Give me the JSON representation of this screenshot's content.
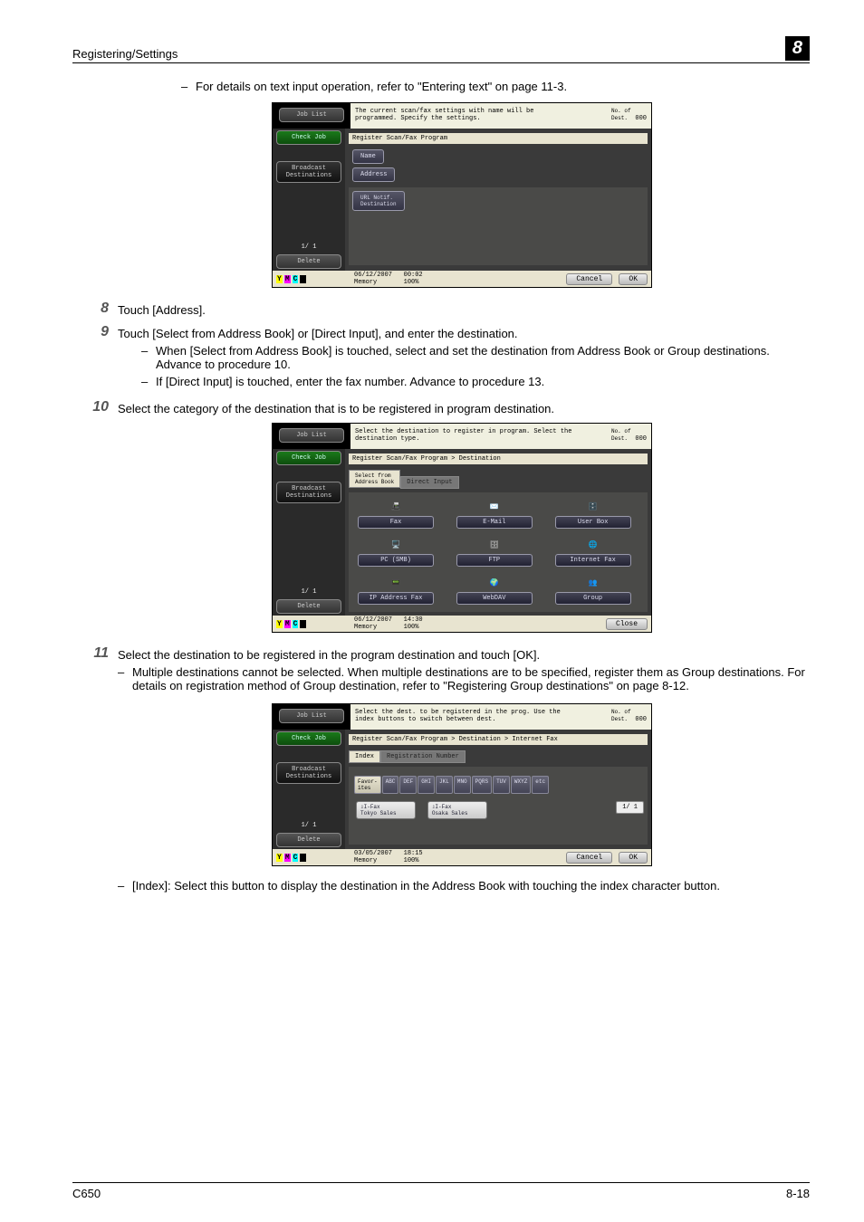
{
  "header": {
    "section": "Registering/Settings",
    "chapter": "8"
  },
  "intro_bullet": "For details on text input operation, refer to \"Entering text\" on page 11-3.",
  "steps": {
    "s8": {
      "num": "8",
      "text": "Touch [Address]."
    },
    "s9": {
      "num": "9",
      "text": "Touch [Select from Address Book] or [Direct Input], and enter the destination.",
      "b1": "When [Select from Address Book] is touched, select and set the destination from Address Book or Group destinations. Advance to procedure 10.",
      "b2": "If [Direct Input] is touched, enter the fax number. Advance to procedure 13."
    },
    "s10": {
      "num": "10",
      "text": "Select the category of the destination that is to be registered in program destination."
    },
    "s11": {
      "num": "11",
      "text": "Select the destination to be registered in the program destination and touch [OK].",
      "b1": "Multiple destinations cannot be selected. When multiple destinations are to be specified, register them as Group destinations. For details on registration method of Group destination, refer to \"Registering Group destinations\" on page 8-12."
    },
    "post_b1": "[Index]: Select this button to display the destination in the Address Book with touching the index character button."
  },
  "screens": {
    "common": {
      "job_list": "Job List",
      "check_job": "Check Job",
      "broadcast": "Broadcast\nDestinations",
      "delete": "Delete",
      "page": "1/  1",
      "dest_label": "No. of\nDest.",
      "dest_count": "000",
      "memory": "Memory",
      "mem_pct": "100%",
      "ymck": {
        "y": "Y",
        "m": "M",
        "c": "C",
        "k": "K"
      }
    },
    "a": {
      "msg": "The current scan/fax settings with name will be programmed. Specify the settings.",
      "bc": "Register Scan/Fax Program",
      "name": "Name",
      "address": "Address",
      "url": "URL Notif.\nDestination",
      "date": "06/12/2007",
      "time": "00:02",
      "cancel": "Cancel",
      "ok": "OK"
    },
    "b": {
      "msg": "Select the destination to register in program. Select the destination type.",
      "bc": "Register Scan/Fax Program > Destination",
      "tab1": "Select from\nAddress Book",
      "tab2": "Direct Input",
      "t1": "Fax",
      "t2": "E-Mail",
      "t3": "User Box",
      "t4": "PC (SMB)",
      "t5": "FTP",
      "t6": "Internet Fax",
      "t7": "IP Address Fax",
      "t8": "WebDAV",
      "t9": "Group",
      "date": "06/12/2007",
      "time": "14:30",
      "close": "Close"
    },
    "c": {
      "msg": "Select the dest. to be registered in the prog. Use the index buttons to switch between dest.",
      "bc": "Register Scan/Fax Program > Destination > Internet Fax",
      "tab1": "Index",
      "tab2": "Registration Number",
      "idx": {
        "fav": "Favor-\nites",
        "abc": "ABC",
        "def": "DEF",
        "ghi": "GHI",
        "jkl": "JKL",
        "mno": "MNO",
        "pqrs": "PQRS",
        "tuv": "TUV",
        "wxyz": "WXYZ",
        "etc": "etc"
      },
      "d1_type": "⇩I-Fax",
      "d1_name": "Tokyo Sales",
      "d2_type": "⇩I-Fax",
      "d2_name": "Osaka Sales",
      "list_page": "1/  1",
      "date": "03/05/2007",
      "time": "18:15",
      "cancel": "Cancel",
      "ok": "OK"
    }
  },
  "footer": {
    "model": "C650",
    "page": "8-18"
  }
}
